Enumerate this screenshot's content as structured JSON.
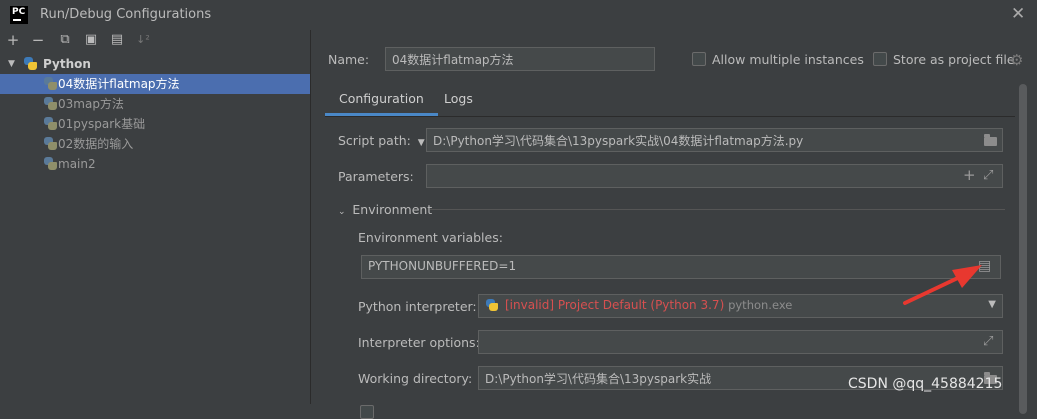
{
  "window": {
    "logo_text": "PC",
    "title": "Run/Debug Configurations",
    "close_glyph": "✕"
  },
  "toolbar": {
    "add": "+",
    "remove": "−",
    "copy": "⧉",
    "save": "▣",
    "folder": "▤",
    "sort": "↓²"
  },
  "tree": {
    "group_label": "Python",
    "items": [
      {
        "label": "04数据计flatmap方法"
      },
      {
        "label": "03map方法"
      },
      {
        "label": "01pyspark基础"
      },
      {
        "label": "02数据的输入"
      },
      {
        "label": "main2"
      }
    ]
  },
  "header": {
    "name_label": "Name:",
    "name_value": "04数据计flatmap方法",
    "allow_multiple_label": "Allow multiple instances",
    "store_project_label": "Store as project file",
    "gear_icon": "gear-icon"
  },
  "tabs": [
    {
      "label": "Configuration"
    },
    {
      "label": "Logs"
    }
  ],
  "config": {
    "script_path_label": "Script path:",
    "script_path_value": "D:\\Python学习\\代码集合\\13pyspark实战\\04数据计flatmap方法.py",
    "parameters_label": "Parameters:",
    "parameters_value": "",
    "environment_section": "Environment",
    "env_vars_label": "Environment variables:",
    "env_vars_value": "PYTHONUNBUFFERED=1",
    "interpreter_label": "Python interpreter:",
    "interpreter_invalid": "[invalid] Project Default (Python 3.7)",
    "interpreter_exe": "python.exe",
    "interpreter_options_label": "Interpreter options:",
    "interpreter_options_value": "",
    "working_dir_label": "Working directory:",
    "working_dir_value": "D:\\Python学习\\代码集合\\13pyspark实战"
  },
  "watermark": "CSDN @qq_45884215",
  "colors": {
    "accent": "#4a88c7",
    "selection": "#4b6eaf",
    "invalid": "#d75050",
    "annotation_arrow": "#e8382f"
  }
}
